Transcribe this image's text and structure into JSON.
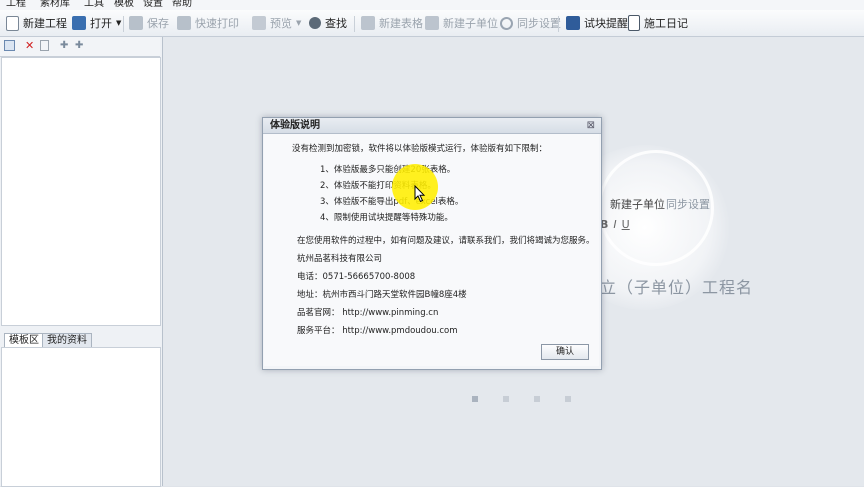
{
  "menubar": [
    "工程",
    "素材库",
    "工具",
    "模板",
    "设置",
    "帮助"
  ],
  "toolbar": {
    "new_project": "新建工程",
    "open": "打开",
    "save": "保存",
    "quick_print": "快速打印",
    "preview": "预览",
    "find": "查找",
    "new_table": "新建表格",
    "new_subunit": "新建子单位",
    "sync_settings": "同步设置",
    "trial_reminder": "试块提醒",
    "construction_log": "施工日记"
  },
  "left_panel": {
    "tabs": [
      "模板区",
      "我的资料"
    ]
  },
  "background": {
    "new_subunit": "新建子单位",
    "sync_settings": "同步设置",
    "format_b": "B",
    "format_i": "I",
    "format_u": "U",
    "large_text": "立（子单位）工程名"
  },
  "dialog": {
    "title": "体验版说明",
    "close": "⊠",
    "intro": "没有检测到加密锁，软件将以体验版模式运行，体验版有如下限制：",
    "limits": [
      "1、体验版最多只能创建20张表格。",
      "2、体验版不能打印资料表格。",
      "3、体验版不能导出pdf、excel表格。",
      "4、限制使用试块提醒等特殊功能。"
    ],
    "feedback": "在您使用软件的过程中，如有问题及建议，请联系我们，我们将竭诚为您服务。",
    "company": "杭州品茗科技有限公司",
    "phone": "电话：0571-56665700-8008",
    "address": "地址：杭州市西斗门路天堂软件园B幢8座4楼",
    "website": "品茗官网：  http://www.pinming.cn",
    "platform": "服务平台：  http://www.pmdoudou.com",
    "ok_label": "确认"
  },
  "colors": {
    "accent_icon": "#3a6fb0",
    "highlight": "#ffee00"
  }
}
